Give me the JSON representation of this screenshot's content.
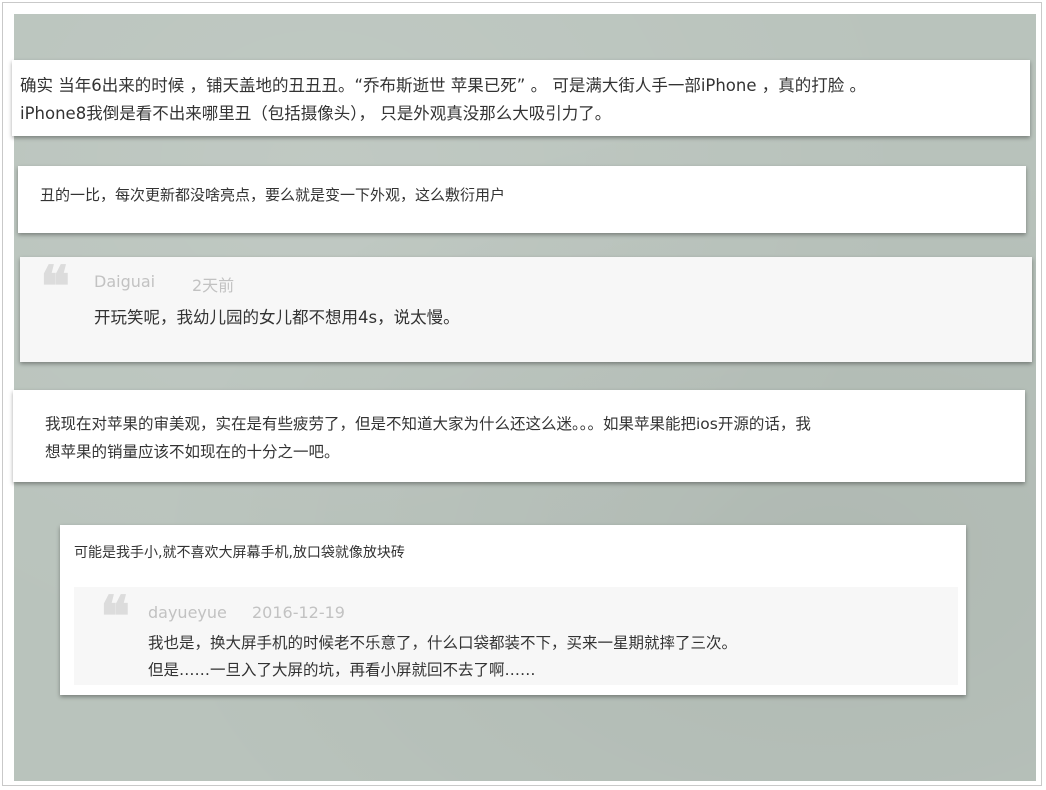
{
  "comment1": {
    "line1": "确实 当年6出来的时候 ，铺天盖地的丑丑丑。“乔布斯逝世 苹果已死” 。 可是满大街人手一部iPhone ，真的打脸 。",
    "line2": "iPhone8我倒是看不出来哪里丑（包括摄像头）， 只是外观真没那么大吸引力了。"
  },
  "comment2": {
    "line1": "丑的一比，每次更新都没啥亮点，要么就是变一下外观，这么敷衍用户"
  },
  "comment3": {
    "quote_icon": "quote-icon",
    "user": "Daiguai",
    "time": "2天前",
    "reply": "开玩笑呢，我幼儿园的女儿都不想用4s，说太慢。"
  },
  "comment4": {
    "line1": "我现在对苹果的审美观，实在是有些疲劳了，但是不知道大家为什么还这么迷。。。如果苹果能把ios开源的话，我",
    "line2": "想苹果的销量应该不如现在的十分之一吧。"
  },
  "comment5": {
    "line1": "可能是我手小,就不喜欢大屏幕手机,放口袋就像放块砖",
    "reply": {
      "quote_icon": "quote-icon",
      "user": "dayueyue",
      "time": "2016-12-19",
      "line1": "我也是，换大屏手机的时候老不乐意了，什么口袋都装不下，买来一星期就摔了三次。",
      "line2": "但是……一旦入了大屏的坑，再看小屏就回不去了啊……"
    }
  }
}
